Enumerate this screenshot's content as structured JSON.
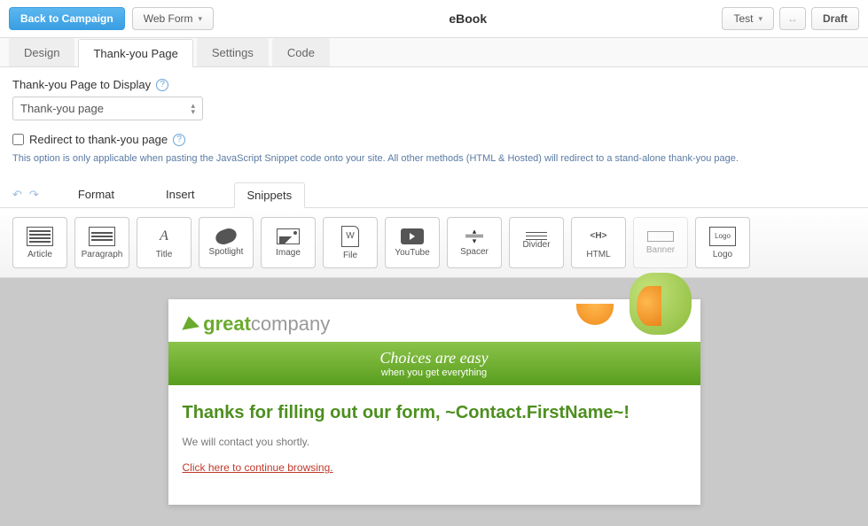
{
  "topbar": {
    "back": "Back to Campaign",
    "webform": "Web Form",
    "title": "eBook",
    "test": "Test",
    "draft": "Draft"
  },
  "tabs": {
    "design": "Design",
    "thankyou": "Thank-you Page",
    "settings": "Settings",
    "code": "Code"
  },
  "thankyou": {
    "label": "Thank-you Page to Display",
    "selected": "Thank-you page",
    "redirect_label": "Redirect to thank-you page",
    "hint": "This option is only applicable when pasting the JavaScript Snippet code onto your site. All other methods (HTML & Hosted) will redirect to a stand-alone thank-you page."
  },
  "editor_tabs": {
    "format": "Format",
    "insert": "Insert",
    "snippets": "Snippets"
  },
  "snippets": {
    "article": "Article",
    "paragraph": "Paragraph",
    "title": "Title",
    "spotlight": "Spotlight",
    "image": "Image",
    "file": "File",
    "youtube": "YouTube",
    "spacer": "Spacer",
    "divider": "Divider",
    "html": "HTML",
    "banner": "Banner",
    "logo": "Logo"
  },
  "preview": {
    "logo_a": "great",
    "logo_b": "company",
    "banner_title": "Choices are easy",
    "banner_sub": "when you get everything",
    "heading": "Thanks for filling out our form, ~Contact.FirstName~!",
    "body": "We will contact you shortly.",
    "link": "Click here to continue browsing."
  }
}
